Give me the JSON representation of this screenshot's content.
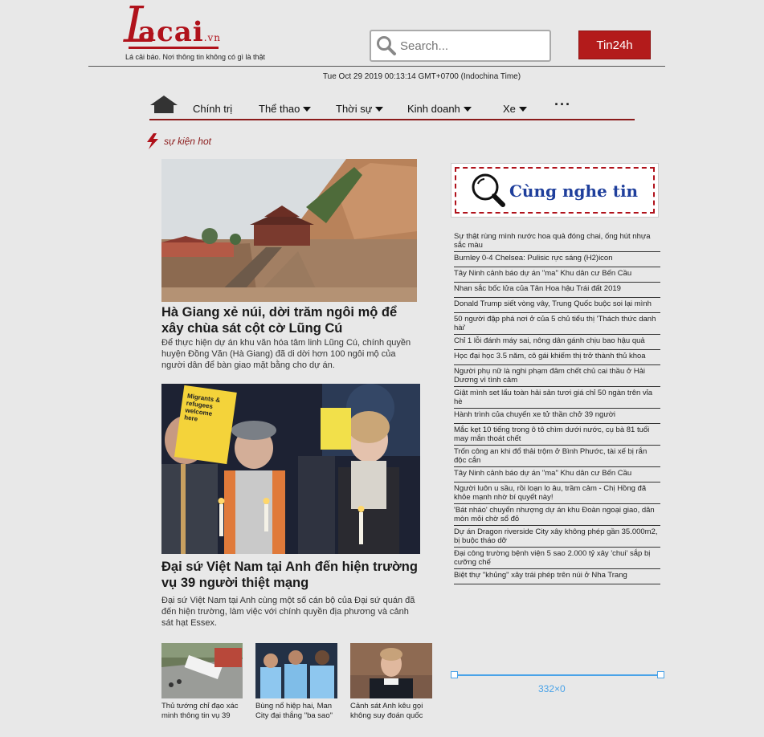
{
  "header": {
    "logo_text": "Lacai",
    "logo_tld": ".vn",
    "tagline": "Lá cải báo. Nơi thông tin không có gì là thật",
    "search_placeholder": "Search...",
    "tin24h_label": "Tin24h",
    "datetime": "Tue Oct 29 2019 00:13:14 GMT+0700 (Indochina Time)"
  },
  "nav": {
    "items": [
      {
        "label": "Chính trị",
        "dropdown": false
      },
      {
        "label": "Thể thao",
        "dropdown": true
      },
      {
        "label": "Thời sự",
        "dropdown": true
      },
      {
        "label": "Kinh doanh",
        "dropdown": true
      },
      {
        "label": "Xe",
        "dropdown": true
      }
    ],
    "more": "···"
  },
  "hot_label": "sự kiện hot",
  "main": {
    "articles": [
      {
        "title": "Hà Giang xẻ núi, dời trăm ngôi mộ để xây chùa sát cột cờ Lũng Cú",
        "summary": "Để thực hiện dự án khu văn hóa tâm linh Lũng Cú, chính quyền huyện Đồng Văn (Hà Giang) đã di dời hơn 100 ngôi mộ của người dân để bàn giao mặt bằng cho dự án."
      },
      {
        "title": "Đại sứ Việt Nam tại Anh đến hiện trường vụ 39 người thiệt mạng",
        "summary": "Đại sứ Việt Nam tại Anh cùng một số cán bộ của Đại sứ quán đã đến hiện trường, làm việc với chính quyền địa phương và cảnh sát hạt Essex.",
        "sign_text": "Migrants & refugees welcome here"
      }
    ],
    "thumbs": [
      {
        "caption": "Thủ tướng chỉ đạo xác minh thông tin vụ 39"
      },
      {
        "caption": "Bùng nổ hiệp hai, Man City đại thắng \"ba sao\""
      },
      {
        "caption": "Cảnh sát Anh kêu gọi không suy đoán quốc"
      }
    ]
  },
  "sidebar": {
    "listen_title": "Cùng nghe tin",
    "news": [
      "Sự thật rùng mình nước hoa quả đóng chai, ống hút nhựa sắc màu",
      "Burnley 0-4 Chelsea: Pulisic rực sáng (H2)icon",
      "Tây Ninh cảnh báo dự án \"ma\" Khu dân cư Bến Cầu",
      "Nhan sắc bốc lửa của Tân Hoa hậu Trái đất 2019",
      "Donald Trump siết vòng vây, Trung Quốc buộc soi lại mình",
      "50 người đập phá nơi ở của 5 chủ tiểu thị 'Thách thức danh hài'",
      "Chỉ 1 lỗi đánh máy sai, nông dân gánh chịu bao hậu quả",
      "Học đại học 3.5 năm, cô gái khiếm thị trở thành thủ khoa",
      "Người phụ nữ là nghi phạm đâm chết chủ cai thầu ở Hải Dương vì tình cảm",
      "Giật mình set lẩu toàn hải sản tươi giá chỉ 50 ngàn trên vỉa hè",
      "Hành trình của chuyến xe tử thần chở 39 người",
      "Mắc kẹt 10 tiếng trong ô tô chìm dưới nước, cụ bà 81 tuổi may mắn thoát chết",
      "Trốn công an khi đổ thải trộm ở Bình Phước, tài xế bị rắn độc cắn",
      "Tây Ninh cảnh báo dự án \"ma\" Khu dân cư Bến Cầu",
      "Người luôn u sầu, rồi loạn lo âu, trầm cảm - Chị Hồng đã khỏe mạnh nhờ bí quyết này!",
      "'Bát nháo' chuyển nhượng dự án khu Đoàn ngoại giao, dân mòn mỏi chờ sổ đỏ",
      "Dự án Dragon riverside City xây không phép gần 35.000m2, bị buộc tháo dỡ",
      "Đại công trường bệnh viện 5 sao 2.000 tỷ xây 'chui' sắp bị cưỡng chế",
      "Biệt thự \"khủng\" xây trái phép trên núi ở Nha Trang"
    ],
    "selection_size": "332×0"
  },
  "colors": {
    "brand_red": "#b0121b",
    "nav_rule": "#8b1a1a",
    "listen_blue": "#1f3f9c",
    "selection_blue": "#4aa3e8"
  }
}
